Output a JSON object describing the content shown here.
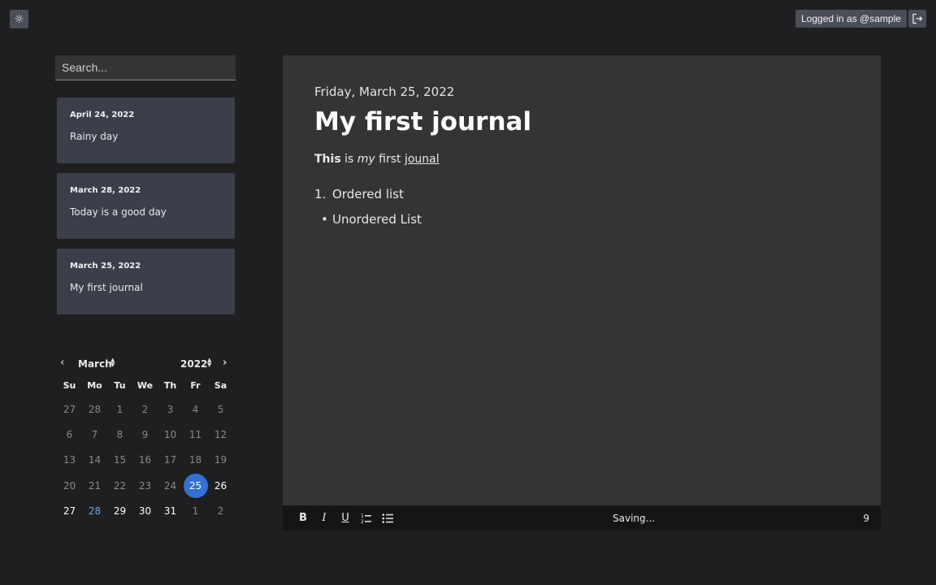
{
  "header": {
    "logged_in_label": "Logged in as @sample",
    "theme_icon": "sun-icon",
    "logout_icon": "logout-icon"
  },
  "search": {
    "placeholder": "Search..."
  },
  "entries": [
    {
      "date": "April 24, 2022",
      "title": "Rainy day"
    },
    {
      "date": "March 28, 2022",
      "title": "Today is a good day"
    },
    {
      "date": "March 25, 2022",
      "title": "My first journal"
    }
  ],
  "calendar": {
    "month": "March",
    "year": "2022",
    "weekdays": [
      "Su",
      "Mo",
      "Tu",
      "We",
      "Th",
      "Fr",
      "Sa"
    ],
    "weeks": [
      [
        "27",
        "28",
        "1",
        "2",
        "3",
        "4",
        "5"
      ],
      [
        "6",
        "7",
        "8",
        "9",
        "10",
        "11",
        "12"
      ],
      [
        "13",
        "14",
        "15",
        "16",
        "17",
        "18",
        "19"
      ],
      [
        "20",
        "21",
        "22",
        "23",
        "24",
        "25",
        "26"
      ],
      [
        "27",
        "28",
        "29",
        "30",
        "31",
        "1",
        "2"
      ]
    ],
    "selected_day": "25",
    "today_day": "28"
  },
  "editor": {
    "date": "Friday, March 25, 2022",
    "title": "My first journal",
    "para_bold": "This",
    "para_text1": " is ",
    "para_italic": "my",
    "para_text2": " first ",
    "para_underline": "jounal",
    "ordered_marker": "1.",
    "ordered_item": "Ordered list",
    "unordered_marker": "•",
    "unordered_item": "Unordered List"
  },
  "toolbar": {
    "bold": "B",
    "italic": "I",
    "underline": "U",
    "status": "Saving...",
    "count": "9"
  },
  "colors": {
    "background": "#1f1f21",
    "card": "#3a3f4a",
    "editor": "#343436",
    "accent": "#3171d8"
  }
}
